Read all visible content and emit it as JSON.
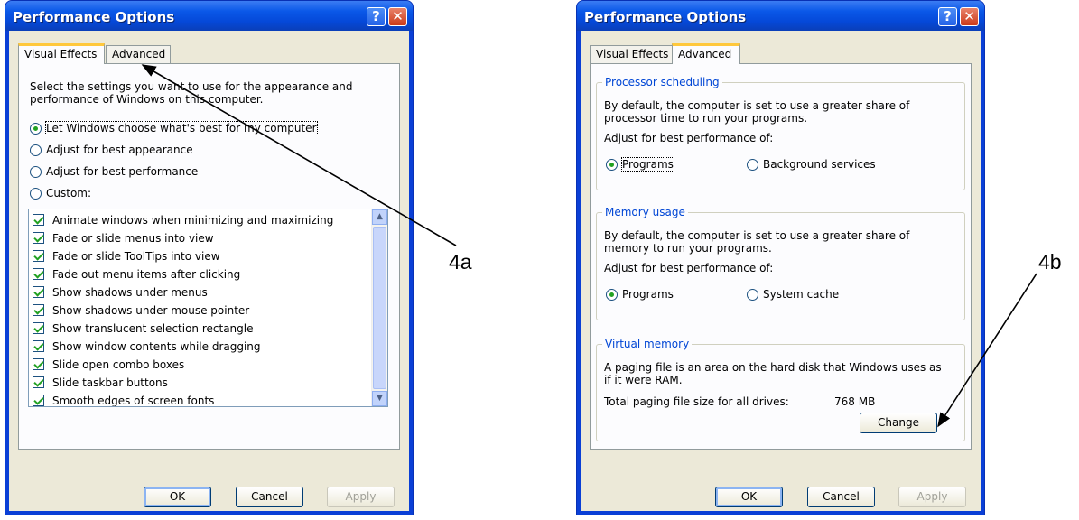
{
  "windows": [
    {
      "title": "Performance Options",
      "tabs": [
        "Visual Effects",
        "Advanced"
      ],
      "intro": [
        "Select the settings you want to use for the appearance and",
        "performance of Windows on this computer."
      ],
      "radios": [
        {
          "label": "Let Windows choose what's best for my computer",
          "selected": true
        },
        {
          "label": "Adjust for best appearance",
          "selected": false
        },
        {
          "label": "Adjust for best performance",
          "selected": false
        },
        {
          "label": "Custom:",
          "selected": false
        }
      ],
      "effects": [
        "Animate windows when minimizing and maximizing",
        "Fade or slide menus into view",
        "Fade or slide ToolTips into view",
        "Fade out menu items after clicking",
        "Show shadows under menus",
        "Show shadows under mouse pointer",
        "Show translucent selection rectangle",
        "Show window contents while dragging",
        "Slide open combo boxes",
        "Slide taskbar buttons",
        "Smooth edges of screen fonts"
      ],
      "buttons": {
        "ok": "OK",
        "cancel": "Cancel",
        "apply": "Apply"
      },
      "help_glyph": "?",
      "close_glyph": "✕"
    },
    {
      "title": "Performance Options",
      "tabs": [
        "Visual Effects",
        "Advanced"
      ],
      "processor": {
        "label": "Processor scheduling",
        "desc": [
          "By default, the computer is set to use a greater share of",
          "processor time to run your programs."
        ],
        "adjust": "Adjust for best performance of:",
        "options": [
          {
            "label": "Programs",
            "selected": true
          },
          {
            "label": "Background services",
            "selected": false
          }
        ]
      },
      "memory": {
        "label": "Memory usage",
        "desc": [
          "By default, the computer is set to use a greater share of",
          "memory to run your programs."
        ],
        "adjust": "Adjust for best performance of:",
        "options": [
          {
            "label": "Programs",
            "selected": true
          },
          {
            "label": "System cache",
            "selected": false
          }
        ]
      },
      "virtual": {
        "label": "Virtual memory",
        "desc": [
          "A paging file is an area on the hard disk that Windows uses as",
          "if it were RAM."
        ],
        "total_label": "Total paging file size for all drives:",
        "total_value": "768 MB",
        "change": "Change"
      },
      "buttons": {
        "ok": "OK",
        "cancel": "Cancel",
        "apply": "Apply"
      },
      "help_glyph": "?",
      "close_glyph": "✕"
    }
  ],
  "callouts": {
    "a": "4a",
    "b": "4b"
  },
  "scroll_up": "▲",
  "scroll_down": "▼"
}
